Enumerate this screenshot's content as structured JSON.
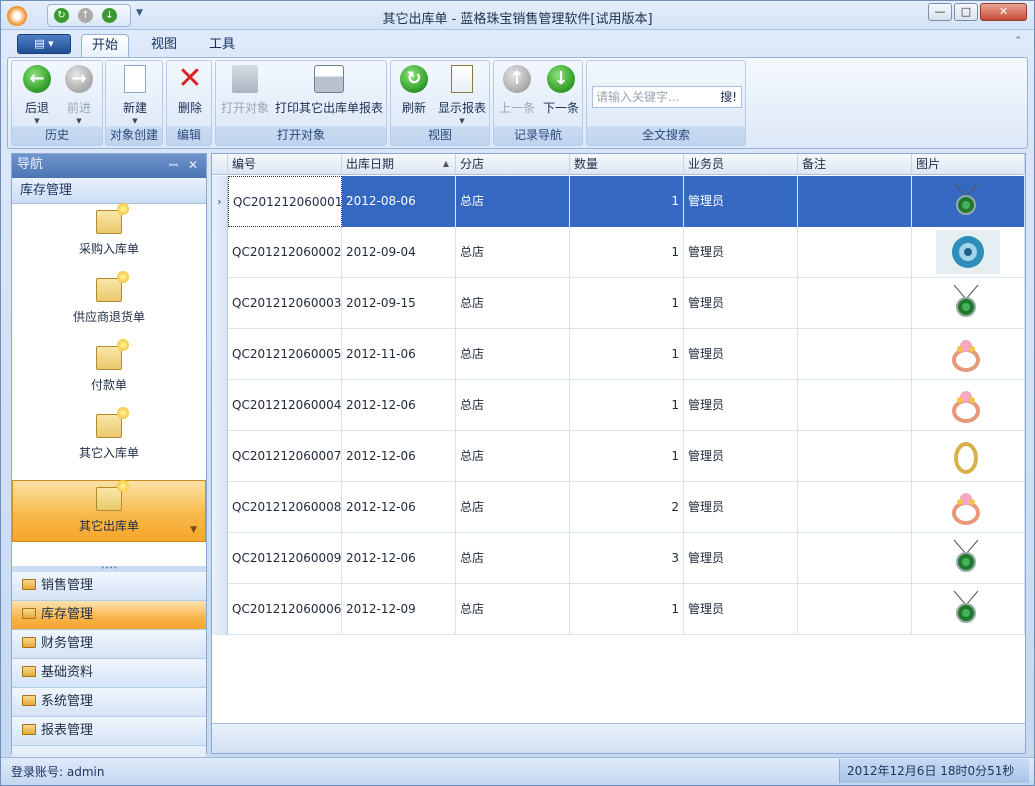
{
  "window": {
    "title": "其它出库单 - 蓝格珠宝销售管理软件[试用版本]"
  },
  "tabs": [
    {
      "label": "开始"
    },
    {
      "label": "视图"
    },
    {
      "label": "工具"
    }
  ],
  "ribbon": {
    "groups": {
      "history": "历史",
      "create": "对象创建",
      "edit": "编辑",
      "open": "打开对象",
      "view": "视图",
      "nav": "记录导航",
      "search": "全文搜索"
    },
    "buttons": {
      "back": "后退",
      "forward": "前进",
      "new": "新建",
      "delete": "删除",
      "open": "打开对象",
      "print": "打印其它出库单报表",
      "refresh": "刷新",
      "report": "显示报表",
      "prev": "上一条",
      "next": "下一条"
    },
    "search": {
      "placeholder": "请输入关键字...",
      "button": "搜!"
    }
  },
  "nav": {
    "header": "导航",
    "section": "库存管理",
    "items": [
      {
        "label": "采购入库单"
      },
      {
        "label": "供应商退货单"
      },
      {
        "label": "付款单"
      },
      {
        "label": "其它入库单"
      },
      {
        "label": "其它出库单"
      }
    ],
    "modules": [
      {
        "label": "销售管理"
      },
      {
        "label": "库存管理"
      },
      {
        "label": "财务管理"
      },
      {
        "label": "基础资料"
      },
      {
        "label": "系统管理"
      },
      {
        "label": "报表管理"
      }
    ]
  },
  "grid": {
    "columns": [
      "编号",
      "出库日期",
      "分店",
      "数量",
      "业务员",
      "备注",
      "图片"
    ],
    "rows": [
      {
        "code": "QC201212060001",
        "date": "2012-08-06",
        "branch": "总店",
        "qty": "1",
        "staff": "管理员",
        "note": "",
        "image": "pendant-green"
      },
      {
        "code": "QC201212060002",
        "date": "2012-09-04",
        "branch": "总店",
        "qty": "1",
        "staff": "管理员",
        "note": "",
        "image": "brooch-blue"
      },
      {
        "code": "QC201212060003",
        "date": "2012-09-15",
        "branch": "总店",
        "qty": "1",
        "staff": "管理员",
        "note": "",
        "image": "pendant-green"
      },
      {
        "code": "QC201212060005",
        "date": "2012-11-06",
        "branch": "总店",
        "qty": "1",
        "staff": "管理员",
        "note": "",
        "image": "ring-rose"
      },
      {
        "code": "QC201212060004",
        "date": "2012-12-06",
        "branch": "总店",
        "qty": "1",
        "staff": "管理员",
        "note": "",
        "image": "ring-rose"
      },
      {
        "code": "QC201212060007",
        "date": "2012-12-06",
        "branch": "总店",
        "qty": "1",
        "staff": "管理员",
        "note": "",
        "image": "ring-gold"
      },
      {
        "code": "QC201212060008",
        "date": "2012-12-06",
        "branch": "总店",
        "qty": "2",
        "staff": "管理员",
        "note": "",
        "image": "ring-rose"
      },
      {
        "code": "QC201212060009",
        "date": "2012-12-06",
        "branch": "总店",
        "qty": "3",
        "staff": "管理员",
        "note": "",
        "image": "pendant-green"
      },
      {
        "code": "QC201212060006",
        "date": "2012-12-09",
        "branch": "总店",
        "qty": "1",
        "staff": "管理员",
        "note": "",
        "image": "pendant-green"
      }
    ]
  },
  "status": {
    "login": "登录账号: admin",
    "clock": "2012年12月6日 18时0分51秒"
  }
}
